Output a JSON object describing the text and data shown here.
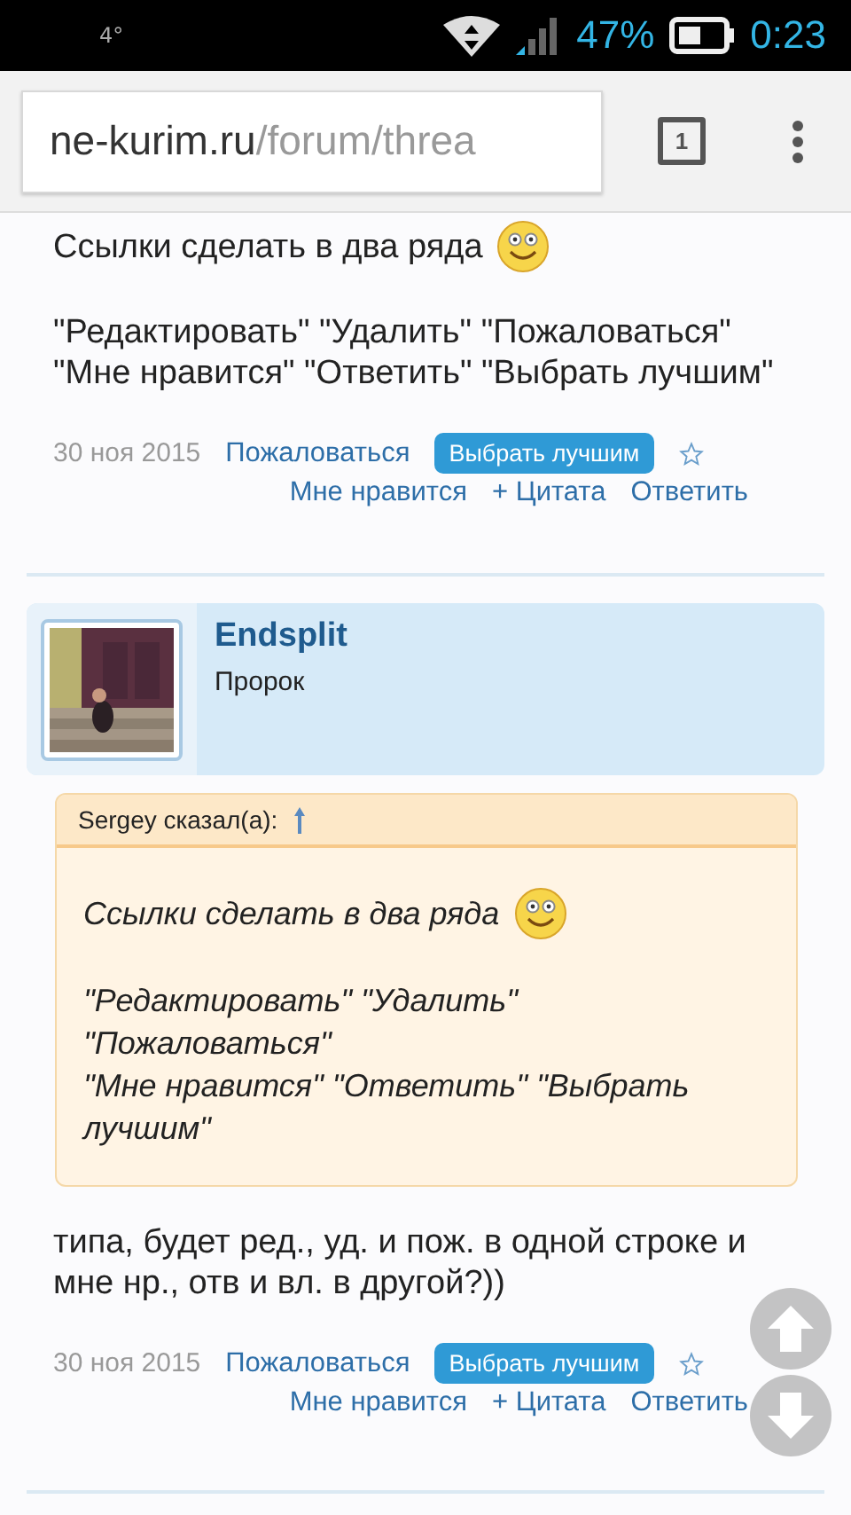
{
  "status_bar": {
    "temperature": "4°",
    "battery": "47%",
    "time": "0:23"
  },
  "address_bar": {
    "domain": "ne-kurim.ru",
    "path": "/forum/threa",
    "tab_count": "1"
  },
  "posts": [
    {
      "cut_line": "Ссылки сделать в два ряда",
      "lines": [
        "\"Редактировать\" \"Удалить\" \"Пожаловаться\"",
        "\"Мне нравится\" \"Ответить\" \"Выбрать лучшим\""
      ],
      "footer": {
        "date": "30 ноя 2015",
        "row1": [
          {
            "kind": "link",
            "label": "Пожаловаться"
          },
          {
            "kind": "button",
            "label": "Выбрать лучшим"
          },
          {
            "kind": "star"
          }
        ],
        "row2": [
          {
            "kind": "link",
            "label": "Мне нравится"
          },
          {
            "kind": "link",
            "label": "+ Цитата"
          },
          {
            "kind": "link",
            "label": "Ответить"
          }
        ]
      }
    },
    {
      "author": {
        "name": "Endsplit",
        "title": "Пророк"
      },
      "quote": {
        "header": "Sergey сказал(а):",
        "first_line": "Ссылки сделать в два ряда",
        "lines": [
          "\"Редактировать\" \"Удалить\"",
          "\"Пожаловаться\"",
          "\"Мне нравится\" \"Ответить\" \"Выбрать лучшим\""
        ]
      },
      "lines": [
        "типа, будет ред., уд. и пож. в одной строке и мне нр., отв и вл. в другой?))"
      ],
      "footer": {
        "date": "30 ноя 2015",
        "row1": [
          {
            "kind": "link",
            "label": "Пожаловаться"
          },
          {
            "kind": "button",
            "label": "Выбрать лучшим"
          },
          {
            "kind": "star"
          }
        ],
        "row2": [
          {
            "kind": "link",
            "label": "Мне нравится"
          },
          {
            "kind": "link",
            "label": "+ Цитата"
          },
          {
            "kind": "link",
            "label": "Ответить"
          }
        ]
      }
    }
  ]
}
